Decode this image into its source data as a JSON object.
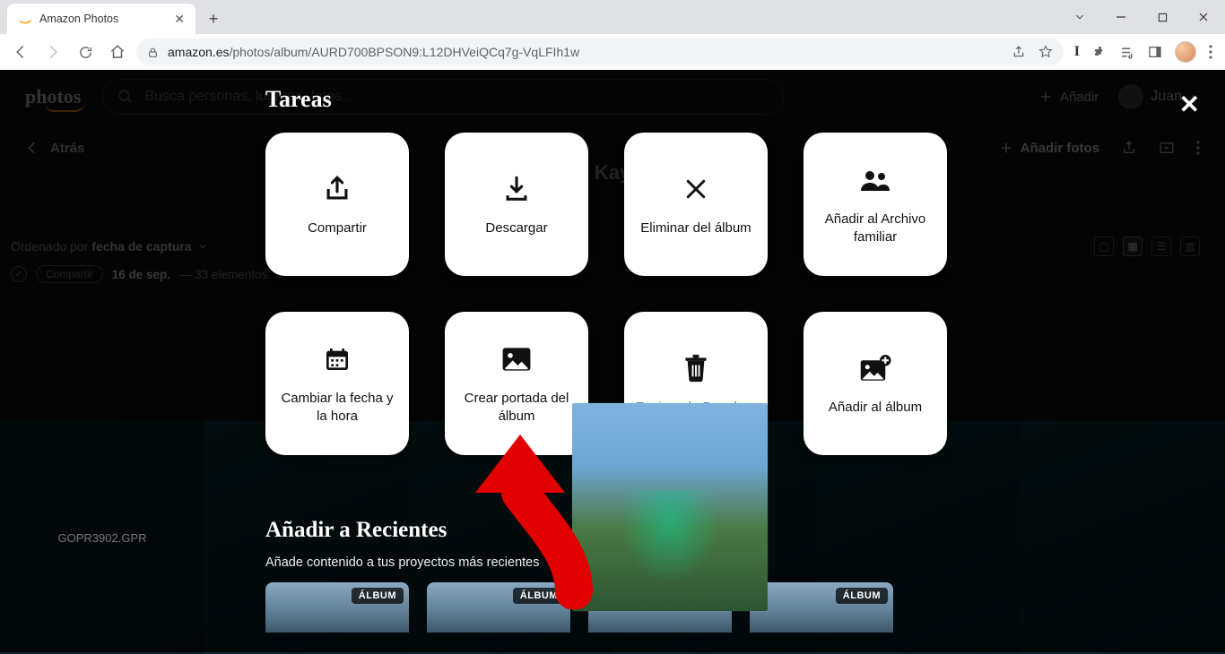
{
  "browser": {
    "tab_title": "Amazon Photos",
    "url_host": "amazon.es",
    "url_path": "/photos/album/AURD700BPSON9:L12DHVeiQCq7g-VqLFIh1w"
  },
  "app": {
    "logo": "photos",
    "search_placeholder": "Busca personas, lugares, fotos...",
    "add_label": "Añadir",
    "user_name": "Juan",
    "back_label": "Atrás",
    "add_photos_label": "Añadir fotos",
    "album_title_hint": "Kay",
    "sort_prefix": "Ordenado por ",
    "sort_value": "fecha de captura",
    "selection_share": "Compartir",
    "selection_date": "16 de sep.",
    "selection_count": "33 elementos",
    "thumb0_label": "GOPR3902.GPR"
  },
  "modal": {
    "title": "Tareas",
    "tiles": [
      {
        "label": "Compartir"
      },
      {
        "label": "Descargar"
      },
      {
        "label": "Eliminar del álbum"
      },
      {
        "label": "Añadir al Archivo familiar"
      },
      {
        "label": "Cambiar la fecha y la hora"
      },
      {
        "label": "Crear portada del álbum"
      },
      {
        "label": "Enviar a la Papelera"
      },
      {
        "label": "Añadir al álbum"
      }
    ],
    "recent_title": "Añadir a Recientes",
    "recent_sub": "Añade contenido a tus proyectos más recientes",
    "badge": "ÁLBUM"
  }
}
